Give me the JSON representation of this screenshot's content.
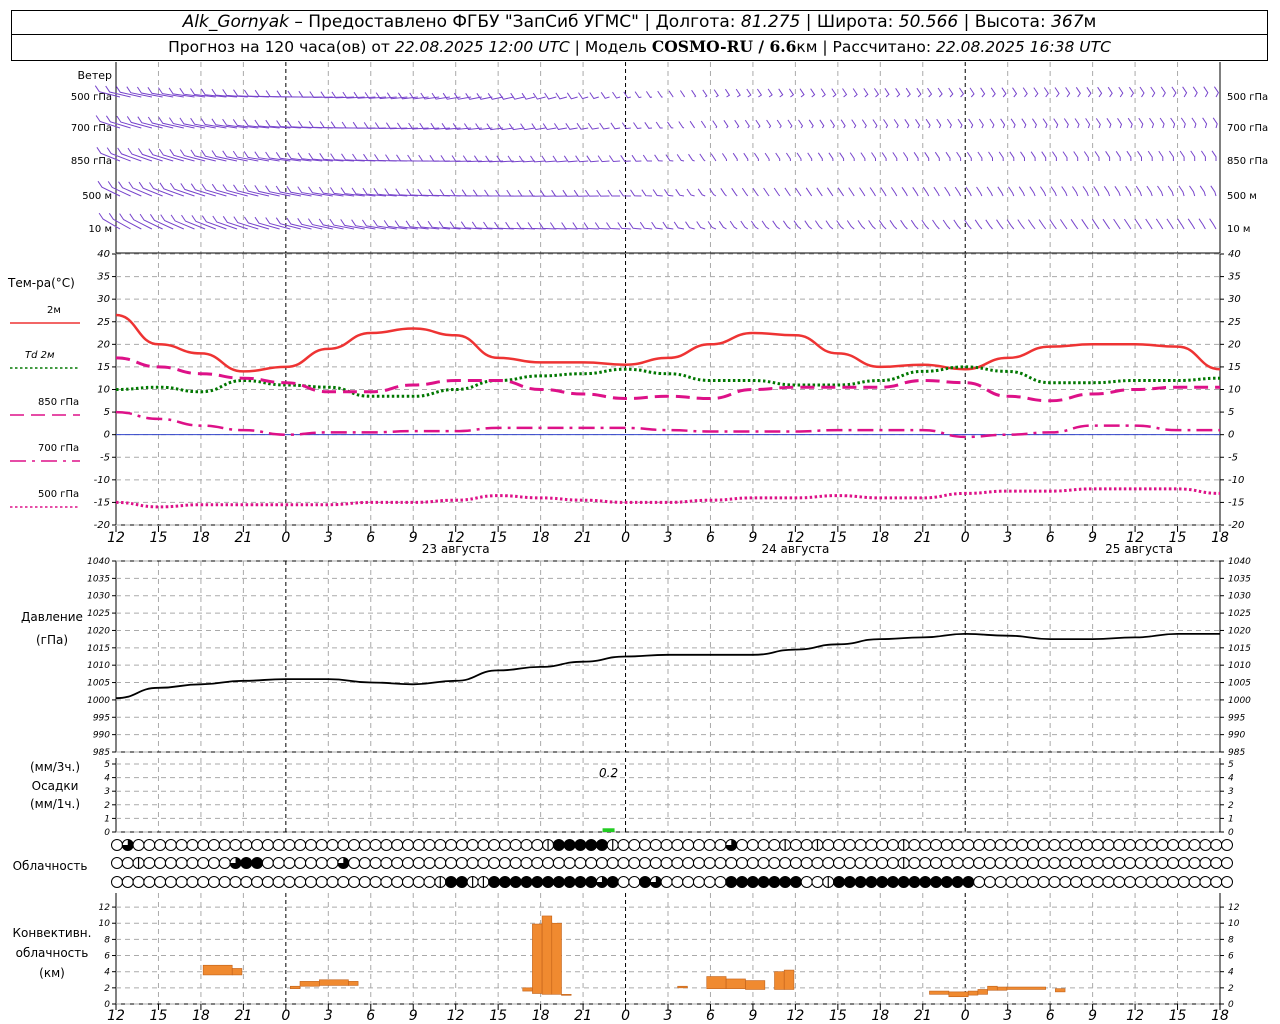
{
  "header": {
    "station": "Alk_Gornyak",
    "provider": " – Предоставлено ФГБУ \"ЗапСиб УГМС\" | Долгота: ",
    "lon": "81.275",
    "lat_label": " | Широта: ",
    "lat": "50.566",
    "alt_label": " | Высота: ",
    "alt": "367",
    "alt_unit": "м",
    "fc_label": "Прогноз на 120 часа(ов) от ",
    "fc_time": "22.08.2025 12:00 UTC",
    "model_label": "  | Модель ",
    "model": "COSMO-RU / 6.6",
    "model_unit": "км",
    "calc_label": " | Рассчитано: ",
    "calc_time": "22.08.2025 16:38 UTC"
  },
  "chart_data": {
    "x_hours": [
      12,
      15,
      18,
      21,
      0,
      3,
      6,
      9,
      12,
      15,
      18,
      21,
      0,
      3,
      6,
      9,
      12,
      15,
      18,
      21,
      0,
      3,
      6,
      9,
      12,
      15,
      18
    ],
    "x_tick_labels": [
      "12",
      "15",
      "18",
      "21",
      "0",
      "3",
      "6",
      "9",
      "12",
      "15",
      "18",
      "21",
      "0",
      "3",
      "6",
      "9",
      "12",
      "15",
      "18",
      "21",
      "0",
      "3",
      "6",
      "9",
      "12",
      "15",
      "18"
    ],
    "day_labels": [
      "23 августа",
      "24 августа",
      "25 августа"
    ],
    "wind": {
      "title": "Ветер",
      "levels": [
        "500 гПа",
        "700 гПа",
        "850 гПа",
        "500 м",
        "10  м"
      ]
    },
    "temperature": {
      "type": "line",
      "ylabel": "Тем-ра(°С)",
      "ylim": [
        -20,
        40
      ],
      "yticks": [
        40,
        35,
        30,
        25,
        20,
        15,
        10,
        5,
        0,
        -5,
        -10,
        -15,
        -20
      ],
      "legend": [
        {
          "label": "2м",
          "color": "#ee3333",
          "style": "solid"
        },
        {
          "label": "Td  2м",
          "color": "#007700",
          "style": "dotted"
        },
        {
          "label": "850 гПа",
          "color": "#dd1188",
          "style": "dashed"
        },
        {
          "label": "700 гПа",
          "color": "#dd1188",
          "style": "dashdot"
        },
        {
          "label": "500 гПа",
          "color": "#dd1188",
          "style": "dotted"
        }
      ],
      "series": [
        {
          "name": "2м",
          "values": [
            26.5,
            20,
            18,
            14,
            15,
            19,
            22.5,
            23.5,
            22,
            17,
            16,
            16,
            15.5,
            17,
            20,
            22.5,
            22,
            18,
            15,
            15.5,
            14.5,
            17,
            19.5,
            20,
            20,
            19.5,
            14.5
          ]
        },
        {
          "name": "Td  2м",
          "values": [
            10,
            10.5,
            9.5,
            12,
            11,
            10.5,
            8.5,
            8.5,
            10,
            12,
            13,
            13.5,
            14.5,
            13.5,
            12,
            12,
            11,
            11,
            12,
            14,
            15,
            14,
            11.5,
            11.5,
            12,
            12,
            12.5
          ]
        },
        {
          "name": "850 гПа",
          "values": [
            17,
            15,
            13.5,
            12.5,
            11.5,
            9.5,
            9.5,
            11,
            12,
            12,
            10,
            9,
            8,
            8.5,
            8,
            10,
            10.5,
            10.5,
            10.5,
            12,
            11.5,
            8.5,
            7.5,
            9,
            10,
            10.5,
            10.5
          ]
        },
        {
          "name": "700 гПа",
          "values": [
            5,
            3.5,
            2,
            1,
            0,
            0.5,
            0.5,
            0.8,
            0.8,
            1.5,
            1.5,
            1.5,
            1.5,
            1,
            0.7,
            0.7,
            0.7,
            1,
            1,
            1,
            -0.5,
            0,
            0.5,
            2,
            2,
            1,
            1
          ]
        },
        {
          "name": "500 гПа",
          "values": [
            -15,
            -16,
            -15.5,
            -15.5,
            -15.5,
            -15.5,
            -15,
            -15,
            -14.5,
            -13.5,
            -14,
            -14.5,
            -15,
            -15,
            -14.5,
            -14,
            -14,
            -13.5,
            -14,
            -14,
            -13,
            -12.5,
            -12.5,
            -12,
            -12,
            -12,
            -13
          ]
        }
      ]
    },
    "pressure": {
      "type": "line",
      "ylabel1": "Давление",
      "ylabel2": "(гПа)",
      "ylim": [
        985,
        1040
      ],
      "yticks": [
        1040,
        1035,
        1030,
        1025,
        1020,
        1015,
        1010,
        1005,
        1000,
        995,
        990,
        985
      ],
      "values": [
        1000.5,
        1003.5,
        1004.5,
        1005.5,
        1006,
        1006,
        1005,
        1004.5,
        1005.5,
        1008.5,
        1009.5,
        1011,
        1012.5,
        1013,
        1013,
        1013,
        1014.5,
        1016,
        1017.5,
        1018,
        1019,
        1018.5,
        1017.5,
        1017.5,
        1018,
        1019,
        1019
      ]
    },
    "precipitation": {
      "type": "bar",
      "ylabel1": "(мм/3ч.)",
      "ylabel2": "Осадки",
      "ylabel3": "(мм/1ч.)",
      "ylim": [
        0,
        5
      ],
      "yticks": [
        5,
        4,
        3,
        2,
        1,
        0
      ],
      "annotation": "0.2",
      "bars": [
        {
          "hour_index": 11.6,
          "value": 0.2
        }
      ]
    },
    "cloudiness": {
      "label": "Облачность",
      "rows": [
        "o3oooooooooooooooooooooooooooooooooooooo1444441oooooooooo3oooo1oo1ooooooo1ooooooooooooooooooooooooooooooooooo",
        "oo1oooooooo344ooooooo3ooooooooooooooooooooooooooooooooooooooooooooooooooo1ooooooooooooooooooooooooooooooooooo3",
        "oooooooooooooooooooooooooooooo14411444444444434oo43oooooo4444444oo14444444444444oooooooooooo"
      ]
    },
    "convective": {
      "type": "bar",
      "ylabel1": "Конвективн.",
      "ylabel2": "облачность",
      "ylabel3": "(км)",
      "ylim": [
        0,
        13
      ],
      "yticks": [
        12,
        10,
        8,
        6,
        4,
        2,
        0
      ],
      "color": "#f08a30",
      "bars": [
        {
          "h0": 9,
          "h1": 12,
          "base": 3.6,
          "top": 4.8
        },
        {
          "h0": 12,
          "h1": 13,
          "base": 3.6,
          "top": 4.4
        },
        {
          "h0": 18,
          "h1": 19,
          "base": 1.9,
          "top": 2.2
        },
        {
          "h0": 19,
          "h1": 21,
          "base": 2.2,
          "top": 2.8
        },
        {
          "h0": 21,
          "h1": 24,
          "base": 2.3,
          "top": 3.0
        },
        {
          "h0": 24,
          "h1": 25,
          "base": 2.3,
          "top": 2.8
        },
        {
          "h0": 42,
          "h1": 43,
          "base": 1.6,
          "top": 2.0
        },
        {
          "h0": 43,
          "h1": 44,
          "base": 1.3,
          "top": 9.9
        },
        {
          "h0": 44,
          "h1": 45,
          "base": 1.2,
          "top": 10.9
        },
        {
          "h0": 45,
          "h1": 46,
          "base": 1.2,
          "top": 10.0
        },
        {
          "h0": 46,
          "h1": 47,
          "base": 1.1,
          "top": 1.2
        },
        {
          "h0": 58,
          "h1": 59,
          "base": 2.0,
          "top": 2.2
        },
        {
          "h0": 61,
          "h1": 63,
          "base": 1.9,
          "top": 3.4
        },
        {
          "h0": 63,
          "h1": 65,
          "base": 1.9,
          "top": 3.1
        },
        {
          "h0": 65,
          "h1": 67,
          "base": 1.8,
          "top": 2.9
        },
        {
          "h0": 68,
          "h1": 69,
          "base": 1.8,
          "top": 4.0
        },
        {
          "h0": 69,
          "h1": 70,
          "base": 1.8,
          "top": 4.2
        },
        {
          "h0": 84,
          "h1": 86,
          "base": 1.2,
          "top": 1.6
        },
        {
          "h0": 86,
          "h1": 88,
          "base": 0.9,
          "top": 1.5
        },
        {
          "h0": 88,
          "h1": 89,
          "base": 1.1,
          "top": 1.6
        },
        {
          "h0": 89,
          "h1": 90,
          "base": 1.2,
          "top": 1.8
        },
        {
          "h0": 90,
          "h1": 91,
          "base": 1.7,
          "top": 2.2
        },
        {
          "h0": 91,
          "h1": 92,
          "base": 1.7,
          "top": 2.1
        },
        {
          "h0": 92,
          "h1": 96,
          "base": 1.8,
          "top": 2.1
        },
        {
          "h0": 97,
          "h1": 98,
          "base": 1.5,
          "top": 1.9
        }
      ]
    }
  }
}
